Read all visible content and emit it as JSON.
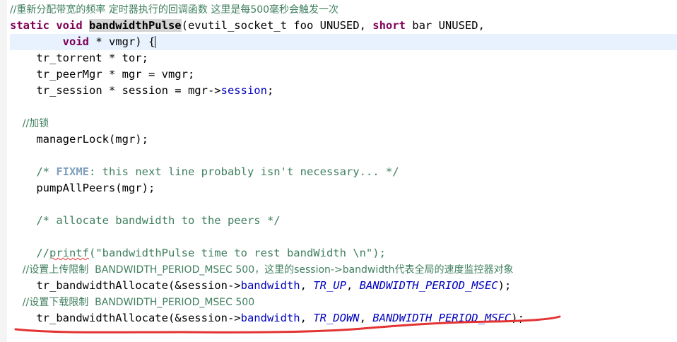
{
  "lines": {
    "l1": "//重新分配带宽的频率 定时器执行的回调函数 这里是每500毫秒会触发一次",
    "l2_kw1": "static void ",
    "l2_fn": "bandwidthPulse",
    "l2_rest1": "(evutil_socket_t foo UNUSED, ",
    "l2_kw2": "short",
    "l2_rest2": " bar UNUSED,",
    "l3_indent": "        ",
    "l3_kw": "void",
    "l3_rest": " * vmgr) {",
    "l4": "    tr_torrent * tor;",
    "l5": "    tr_peerMgr * mgr = vmgr;",
    "l6_a": "    tr_session * session = mgr->",
    "l6_b": "session",
    "l6_c": ";",
    "l7": "",
    "l8": "    //加锁",
    "l9": "    managerLock(mgr);",
    "l10": "",
    "l11_a": "    /* ",
    "l11_tag": "FIXME",
    "l11_b": ": this next line probably isn't necessary... */",
    "l12": "    pumpAllPeers(mgr);",
    "l13": "",
    "l14": "    /* allocate bandwidth to the peers */",
    "l15": "",
    "l16_a": "    //",
    "l16_b": "printf",
    "l16_c": "(\"bandwidthPulse time to rest bandWidth \\n\");",
    "l17": "    //设置上传限制  BANDWIDTH_PERIOD_MSEC 500，这里的session->bandwidth代表全局的速度监控器对象",
    "l18_a": "    tr_bandwidthAllocate(&session->",
    "l18_b": "bandwidth",
    "l18_c": ", ",
    "l18_d": "TR_UP",
    "l18_e": ", ",
    "l18_f": "BANDWIDTH_PERIOD_MSEC",
    "l18_g": ");",
    "l19": "    //设置下载限制  BANDWIDTH_PERIOD_MSEC 500",
    "l20_a": "    tr_bandwidthAllocate(&session->",
    "l20_b": "bandwidth",
    "l20_c": ", ",
    "l20_d": "TR_DOWN",
    "l20_e": ", ",
    "l20_f": "BANDWIDTH_PERIOD_MSEC",
    "l20_g": ");"
  },
  "colors": {
    "keyword": "#7f0055",
    "comment": "#3f7f5f",
    "field": "#0000c0",
    "annotation": "#e33333",
    "current_line": "#e8f2fe"
  }
}
